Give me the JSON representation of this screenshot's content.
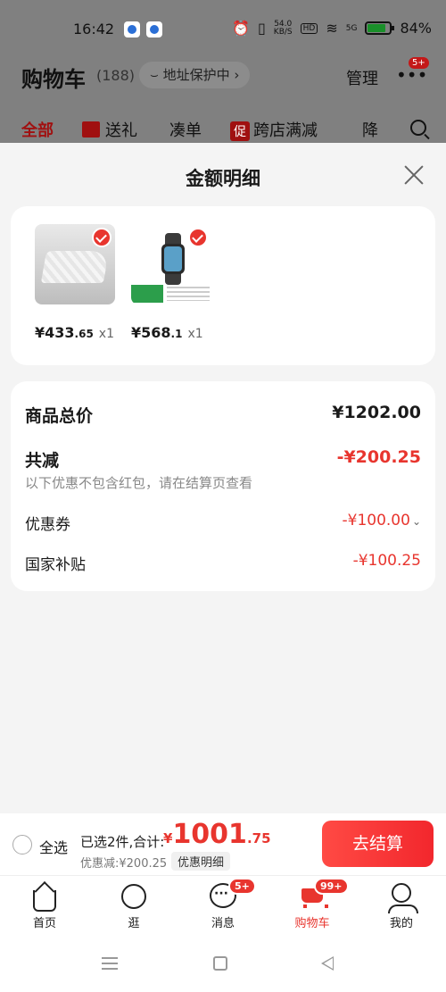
{
  "status_bar": {
    "time": "16:42",
    "net_speed_value": "54.0",
    "net_speed_unit": "KB/S",
    "hd": "HD",
    "signal": "5G",
    "battery_percent": "84%"
  },
  "background_page": {
    "title": "购物车",
    "count": "(188)",
    "address": "地址保护中",
    "manage": "管理",
    "more_badge": "5+",
    "tabs": [
      {
        "label": "全部"
      },
      {
        "label": "送礼"
      },
      {
        "label": "凑单"
      },
      {
        "label": "跨店满减",
        "tag": "促"
      },
      {
        "label": "降"
      }
    ]
  },
  "sheet": {
    "title": "金额明细",
    "products": [
      {
        "price_int": "¥433",
        "price_dec": ".65",
        "qty": "x1"
      },
      {
        "price_int": "¥568",
        "price_dec": ".1",
        "qty": "x1"
      }
    ],
    "summary": {
      "total_label": "商品总价",
      "total_value": "¥1202.00",
      "reduce_label": "共减",
      "reduce_value": "-¥200.25",
      "note": "以下优惠不包含红包，请在结算页查看",
      "coupon_label": "优惠券",
      "coupon_value": "-¥100.00",
      "subsidy_label": "国家补贴",
      "subsidy_value": "-¥100.25"
    }
  },
  "checkout": {
    "select_all": "全选",
    "selected_text": "已选2件,合计:",
    "total_yen": "¥",
    "total_int": "1001",
    "total_dec": ".75",
    "discount_text": "优惠减:¥200.25",
    "detail_chip": "优惠明细",
    "checkout_button": "去结算"
  },
  "nav": {
    "items": [
      {
        "label": "首页"
      },
      {
        "label": "逛"
      },
      {
        "label": "消息",
        "badge": "5+"
      },
      {
        "label": "购物车",
        "badge": "99+"
      },
      {
        "label": "我的"
      }
    ]
  },
  "colors": {
    "accent": "#e8352e",
    "overlay": "#808080"
  }
}
